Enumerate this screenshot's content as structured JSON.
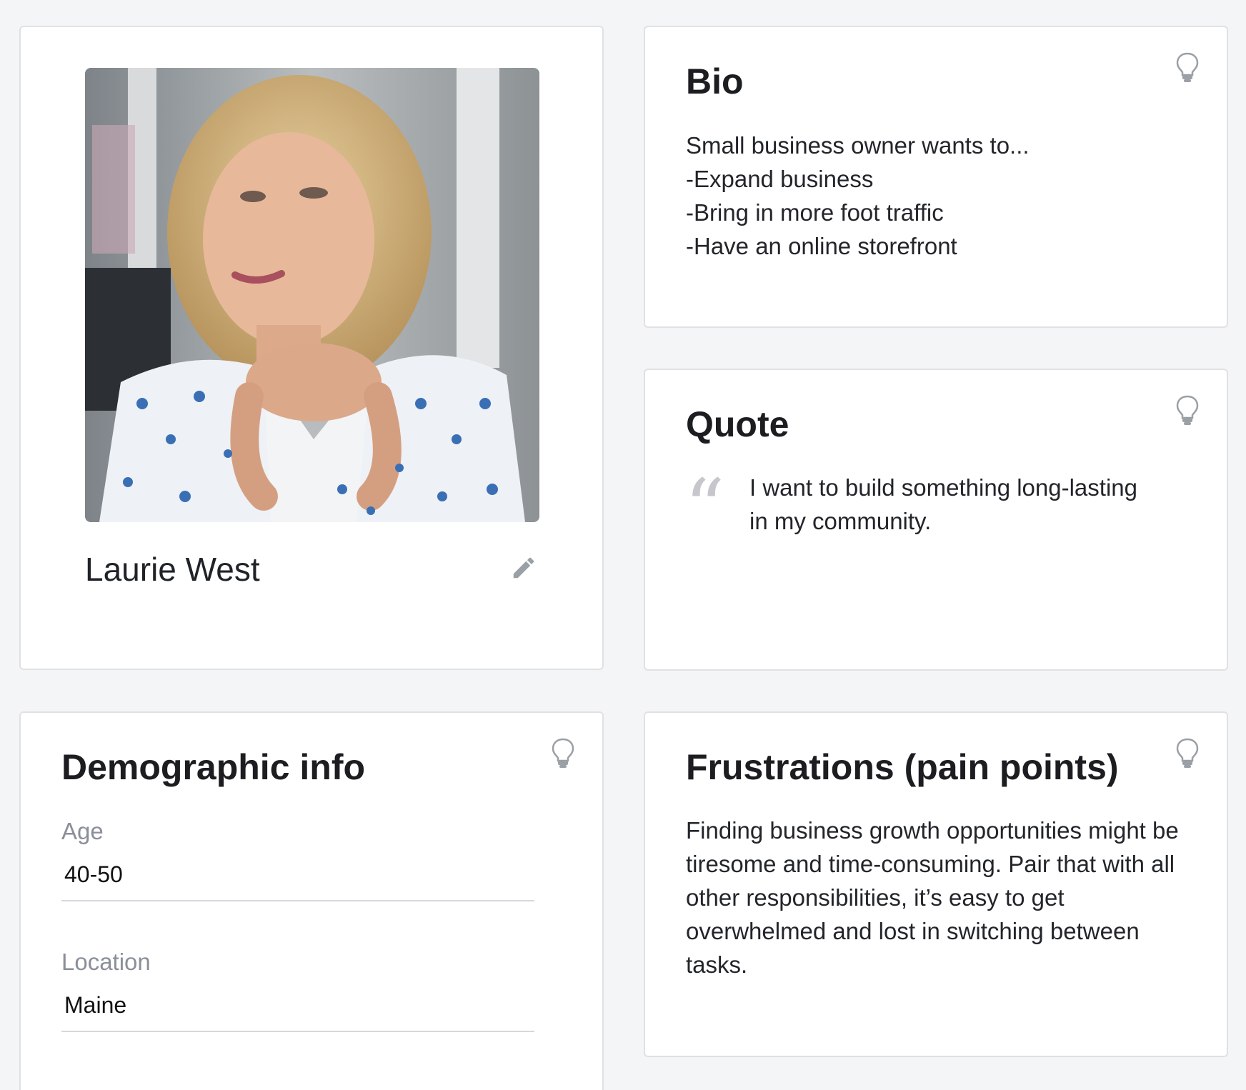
{
  "profile": {
    "name": "Laurie West",
    "photo_icon": "person-photo",
    "edit_icon": "pencil-icon"
  },
  "bio": {
    "title": "Bio",
    "lines": [
      "Small business owner wants to...",
      "-Expand business",
      "-Bring in more foot traffic",
      "-Have an online storefront"
    ]
  },
  "quote": {
    "title": "Quote",
    "mark": "“",
    "text": "I want to build something long-lasting in my community."
  },
  "demographic": {
    "title": "Demographic info",
    "age_label": "Age",
    "age_value": "40-50",
    "location_label": "Location",
    "location_value": "Maine"
  },
  "frustrations": {
    "title": "Frustrations (pain points)",
    "text": "Finding business growth opportunities might be tiresome and time-consuming. Pair that with all other responsibilities, it’s easy to get overwhelmed and lost in switching between tasks."
  },
  "colors": {
    "background": "#f4f5f7",
    "card_border": "#dfe1e5",
    "muted_text": "#8a8f98",
    "icon_gray": "#9aa0a6"
  }
}
